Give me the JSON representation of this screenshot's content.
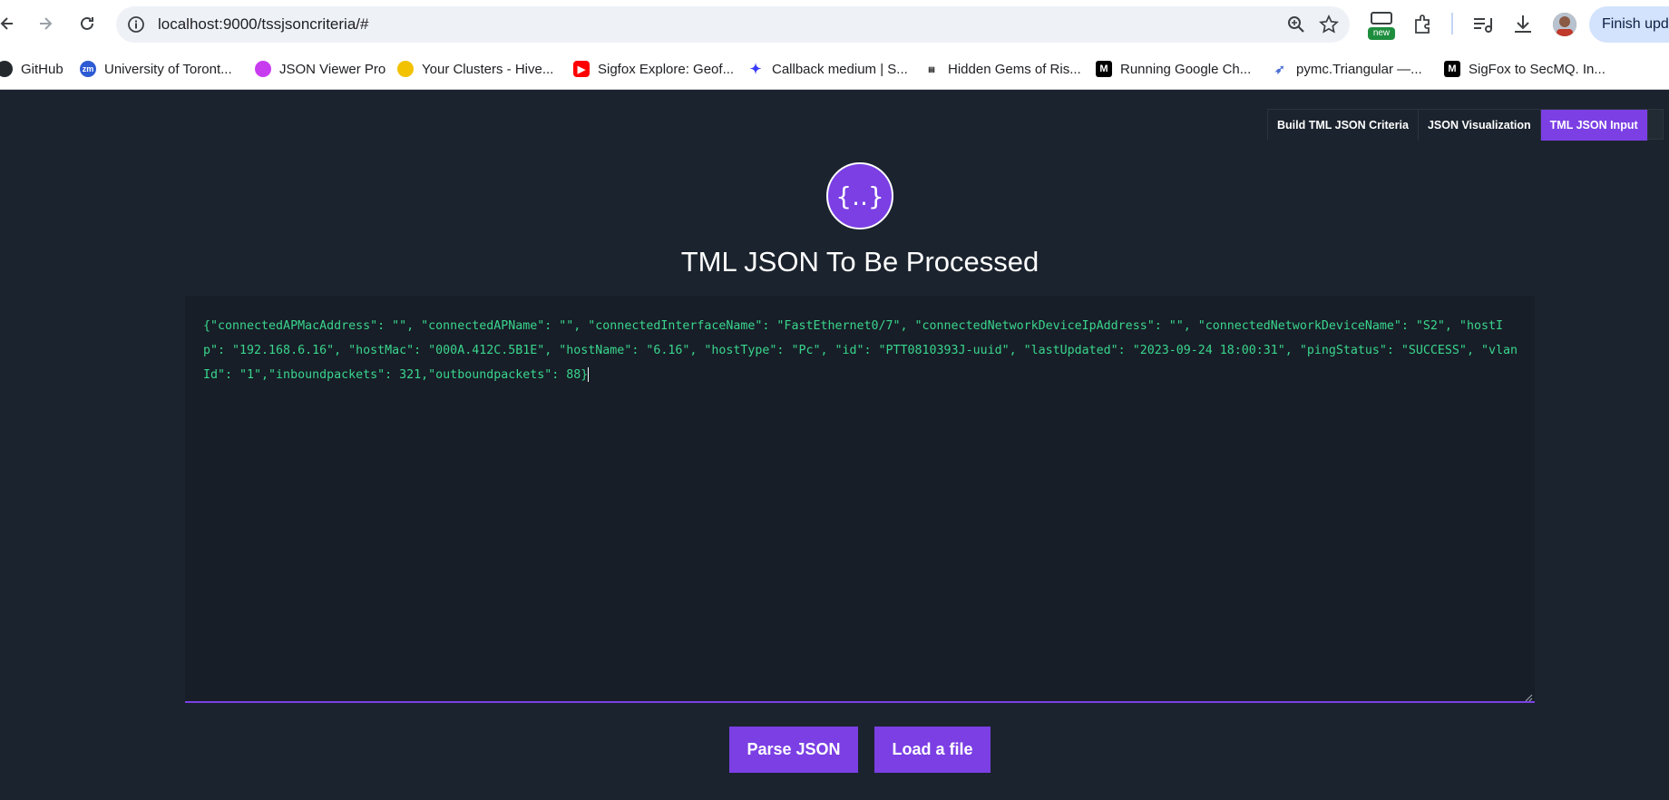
{
  "browser": {
    "url": "localhost:9000/tssjsoncriteria/#",
    "new_badge": "new",
    "finish_update_label": "Finish upda"
  },
  "bookmarks": [
    {
      "label": "GitHub",
      "icon": "github-icon"
    },
    {
      "label": "University of Toront...",
      "icon": "zoom-icon"
    },
    {
      "label": "JSON Viewer Pro",
      "icon": "json-viewer-icon"
    },
    {
      "label": "Your Clusters - Hive...",
      "icon": "hive-icon"
    },
    {
      "label": "Sigfox Explore: Geof...",
      "icon": "youtube-icon"
    },
    {
      "label": "Callback medium | S...",
      "icon": "butterfly-icon"
    },
    {
      "label": "Hidden Gems of Ris...",
      "icon": "book-icon"
    },
    {
      "label": "Running Google Ch...",
      "icon": "medium-icon"
    },
    {
      "label": "pymc.Triangular —...",
      "icon": "rocket-icon"
    },
    {
      "label": "SigFox to SecMQ. In...",
      "icon": "medium-icon"
    }
  ],
  "tabs": [
    {
      "label": "Build TML JSON Criteria"
    },
    {
      "label": "JSON Visualization"
    },
    {
      "label": "TML JSON Input"
    }
  ],
  "logo_text": "{..}",
  "heading": "TML JSON To Be Processed",
  "editor": {
    "value": "{\"connectedAPMacAddress\": \"\", \"connectedAPName\": \"\", \"connectedInterfaceName\": \"FastEthernet0/7\", \"connectedNetworkDeviceIpAddress\": \"\", \"connectedNetworkDeviceName\": \"S2\", \"hostIp\": \"192.168.6.16\", \"hostMac\": \"000A.412C.5B1E\", \"hostName\": \"6.16\", \"hostType\": \"Pc\", \"id\": \"PTT0810393J-uuid\", \"lastUpdated\": \"2023-09-24 18:00:31\", \"pingStatus\": \"SUCCESS\", \"vlanId\": \"1\",\"inboundpackets\": 321,\"outboundpackets\": 88}"
  },
  "buttons": {
    "parse": "Parse JSON",
    "load": "Load a file"
  },
  "colors": {
    "accent": "#7b3fe4",
    "background": "#1b232e",
    "json_text": "#3ad58d"
  }
}
